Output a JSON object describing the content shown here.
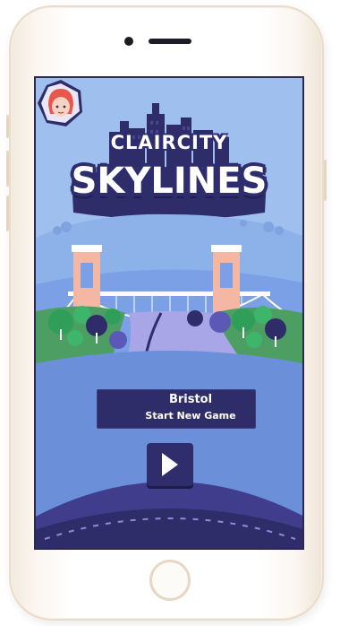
{
  "game": {
    "logo_top": "CLAIRCITY",
    "logo_main": "SKYLINES"
  },
  "city_selector": {
    "city_name": "Bristol",
    "action_label": "Start New Game"
  },
  "play": {
    "icon": "play-icon"
  },
  "colors": {
    "sky": "#9fc0ef",
    "navy": "#2e2d6a",
    "river": "#a9a6e8",
    "tower": "#f3b7a3",
    "trees": "#2f9e58"
  }
}
